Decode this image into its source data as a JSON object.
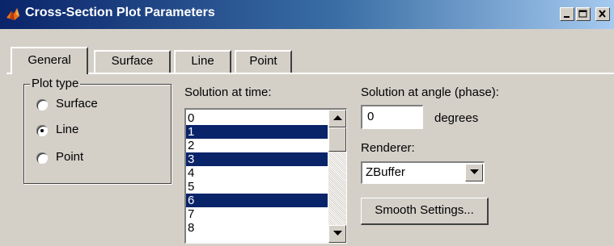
{
  "window": {
    "title": "Cross-Section Plot Parameters",
    "title_bar_color": "#0a246a"
  },
  "tabs": [
    {
      "label": "General",
      "active": true
    },
    {
      "label": "Surface",
      "active": false
    },
    {
      "label": "Line",
      "active": false
    },
    {
      "label": "Point",
      "active": false
    }
  ],
  "plot_type": {
    "legend": "Plot type",
    "options": [
      {
        "label": "Surface",
        "selected": false
      },
      {
        "label": "Line",
        "selected": true
      },
      {
        "label": "Point",
        "selected": false
      }
    ]
  },
  "solution_time": {
    "label": "Solution at time:",
    "items": [
      {
        "label": "0",
        "selected": false
      },
      {
        "label": "1",
        "selected": true
      },
      {
        "label": "2",
        "selected": false
      },
      {
        "label": "3",
        "selected": true
      },
      {
        "label": "4",
        "selected": false
      },
      {
        "label": "5",
        "selected": false
      },
      {
        "label": "6",
        "selected": true
      },
      {
        "label": "7",
        "selected": false
      },
      {
        "label": "8",
        "selected": false
      }
    ],
    "selection_color": "#0a246a"
  },
  "solution_angle": {
    "label": "Solution at angle (phase):",
    "value": "0",
    "unit": "degrees"
  },
  "renderer": {
    "label": "Renderer:",
    "value": "ZBuffer"
  },
  "smooth_button": {
    "label": "Smooth Settings..."
  }
}
